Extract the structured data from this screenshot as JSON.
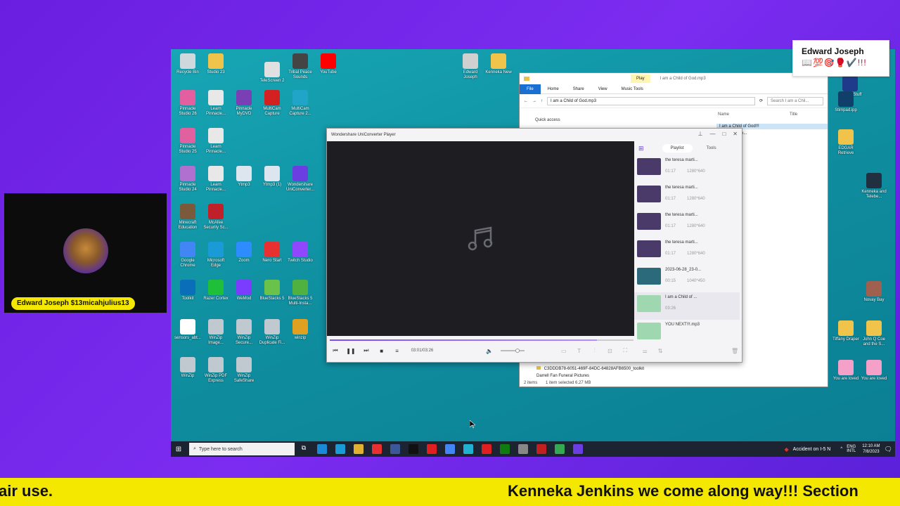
{
  "desktop": {
    "icons": [
      {
        "label": "Recycle Bin",
        "color": "#cfd8dc"
      },
      {
        "label": "Studio 23",
        "color": "#f0c34a"
      },
      {
        "label": "TeleScreen 2",
        "color": "#e0e0e0"
      },
      {
        "label": "Tribal Peace Sounds",
        "color": "#444444"
      },
      {
        "label": "YouTube",
        "color": "#ff0000"
      },
      {
        "label": "Pinnacle Studio 26",
        "color": "#e45fa0"
      },
      {
        "label": "Learn Pinnacle...",
        "color": "#e8e8e8"
      },
      {
        "label": "Pinnacle MyDVD",
        "color": "#7b3fb5"
      },
      {
        "label": "MultiCam Capture",
        "color": "#d32020"
      },
      {
        "label": "MultiCam Capture 2...",
        "color": "#20a5c8"
      },
      {
        "label": "Pinnacle Studio 25",
        "color": "#e060a0"
      },
      {
        "label": "Learn Pinnacle...",
        "color": "#e8e8e8"
      },
      {
        "label": "Pinnacle Studio 24",
        "color": "#b070d0"
      },
      {
        "label": "Learn Pinnacle...",
        "color": "#e8e8e8"
      },
      {
        "label": "Ytmp3",
        "color": "#dde6ee"
      },
      {
        "label": "Ytmp3 (1)",
        "color": "#dde6ee"
      },
      {
        "label": "Wondershare UniConverter...",
        "color": "#6a3ee0"
      },
      {
        "label": "Minecraft Education",
        "color": "#7a5a3a"
      },
      {
        "label": "McAfee Security Sc...",
        "color": "#c0202a"
      },
      {
        "label": "Google Chrome",
        "color": "#4285f4"
      },
      {
        "label": "Microsoft Edge",
        "color": "#1a9ad6"
      },
      {
        "label": "Zoom",
        "color": "#2d8cff"
      },
      {
        "label": "Nero Start",
        "color": "#e83030"
      },
      {
        "label": "Twitch Studio",
        "color": "#9146ff"
      },
      {
        "label": "Toolkit",
        "color": "#0a6fb8"
      },
      {
        "label": "Razer Cortex",
        "color": "#1fbf3a"
      },
      {
        "label": "WeMod",
        "color": "#7b3cff"
      },
      {
        "label": "BlueStacks 5",
        "color": "#6bc24a"
      },
      {
        "label": "BlueStacks 5 Multi-Insta...",
        "color": "#50b040"
      },
      {
        "label": "sensors_abt...",
        "color": "#ffffff"
      },
      {
        "label": "WinZip Image...",
        "color": "#c0c8d0"
      },
      {
        "label": "WinZip Secure...",
        "color": "#c0c8d0"
      },
      {
        "label": "WinZip Duplicate Fi...",
        "color": "#c0c8d0"
      },
      {
        "label": "winzip",
        "color": "#e0a020"
      },
      {
        "label": "WinZip",
        "color": "#c0c8d0"
      },
      {
        "label": "WinZip PDF Express",
        "color": "#c0c8d0"
      },
      {
        "label": "WinZip SafeShare",
        "color": "#c0c8d0"
      },
      {
        "label": "Edward Joseph",
        "color": "#d0d0d0"
      },
      {
        "label": "Kenneka New",
        "color": "#f0c34a"
      },
      {
        "label": "Gospel Stuff",
        "color": "#1f3a8a"
      },
      {
        "label": "Stimpad.ipp",
        "color": "#10406a"
      },
      {
        "label": "EDGAR Retrieve",
        "color": "#f0c34a"
      },
      {
        "label": "Kenneka and Telebe...",
        "color": "#203040"
      },
      {
        "label": "Novay Bay",
        "color": "#a06050"
      },
      {
        "label": "Tiffany Draper",
        "color": "#f0c34a"
      },
      {
        "label": "John Q Coe and the S...",
        "color": "#f0c34a"
      },
      {
        "label": "You are loved",
        "color": "#f5a0c8"
      },
      {
        "label": "You are loved",
        "color": "#f5a0c8"
      }
    ]
  },
  "explorer": {
    "play_tab": "Play",
    "title": "I am a Child of God.mp3",
    "tabs": [
      "File",
      "Home",
      "Share",
      "View",
      "Music Tools"
    ],
    "address": "I am a Child of God.mp3",
    "search_placeholder": "Search I am a Chil...",
    "nav_quick_access": "Quick access",
    "col_name": "Name",
    "col_title": "Title",
    "files": [
      "I am a Child of God!!!",
      "_sktterting_e..."
    ],
    "bottom_files": [
      "C3DDDB78-6051-469F-84DC-64828AFB6500_toolkit",
      "Darrell Fan Funeral Pictures"
    ],
    "status_items": "2 items",
    "status_selected": "1 item selected  6.27 MB"
  },
  "player": {
    "title": "Wondershare UniConverter Player",
    "time": "03:01/03:26",
    "progress_fraction": 0.88,
    "volume_fraction": 0.7,
    "tabs": {
      "playlist": "Playlist",
      "tools": "Tools"
    },
    "playlist": [
      {
        "name": "the teresa marti...",
        "duration": "01:17",
        "res": "1280*640",
        "color": "#4a3a6a"
      },
      {
        "name": "the teresa marti...",
        "duration": "01:17",
        "res": "1280*640",
        "color": "#4a3a6a"
      },
      {
        "name": "the teresa marti...",
        "duration": "01:17",
        "res": "1280*640",
        "color": "#4a3a6a"
      },
      {
        "name": "the teresa marti...",
        "duration": "01:17",
        "res": "1280*640",
        "color": "#4a3a6a"
      },
      {
        "name": "2023-06-28_23-0...",
        "duration": "00:15",
        "res": "1040*450",
        "color": "#2a6a7a"
      },
      {
        "name": "I am a Child of ...",
        "duration": "03:26",
        "res": "",
        "color": "#9fd8b0"
      },
      {
        "name": "YOU NEXT!!!.mp3",
        "duration": "",
        "res": "",
        "color": "#9fd8b0"
      }
    ]
  },
  "taskbar": {
    "search_placeholder": "Type here to search",
    "notification": "Accident on I-5 N",
    "lang": "ENG INTL",
    "time": "12:10 AM",
    "date": "7/8/2023",
    "apps": [
      "#1a8ad6",
      "#1a9ad6",
      "#e0b030",
      "#e83030",
      "#3b5998",
      "#111111",
      "#e02020",
      "#4285f4",
      "#20b0d0",
      "#e02020",
      "#107c10",
      "#888888",
      "#c02020",
      "#34a853",
      "#6a3ee0"
    ]
  },
  "webcam": {
    "label": "Edward Joseph $13micahjulius13"
  },
  "namecard": {
    "name": "Edward Joseph",
    "emoji": "📖💯🎯🥊✔️!!!"
  },
  "ticker": {
    "left_text": "air use.",
    "right_text": "Kenneka Jenkins we come along way!!! Section"
  }
}
